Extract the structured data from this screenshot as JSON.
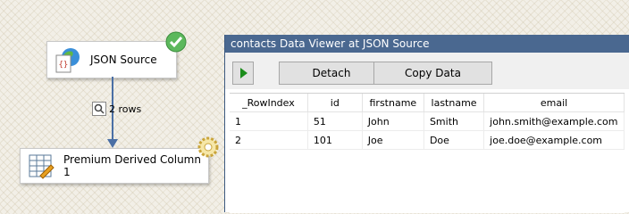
{
  "canvas": {
    "json_source": {
      "label": "JSON Source",
      "icon": "json-source-icon",
      "status_icon": "check-badge-icon"
    },
    "derived_column": {
      "label": "Premium Derived Column 1",
      "icon": "derived-column-icon",
      "status_icon": "gear-badge-icon"
    },
    "connector": {
      "label": "2 rows",
      "icon": "data-viewer-icon"
    }
  },
  "viewer": {
    "title": "contacts Data Viewer at JSON Source",
    "toolbar": {
      "play_icon": "play-icon",
      "detach_label": "Detach",
      "copy_label": "Copy Data"
    },
    "columns": [
      "_RowIndex",
      "id",
      "firstname",
      "lastname",
      "email"
    ],
    "rows": [
      [
        "1",
        "51",
        "John",
        "Smith",
        "john.smith@example.com"
      ],
      [
        "2",
        "101",
        "Joe",
        "Doe",
        "joe.doe@example.com"
      ]
    ]
  },
  "colors": {
    "title_bar": "#4a6890",
    "connector": "#4a6fa5",
    "play": "#1a8c1a",
    "check": "#5cb85c"
  }
}
